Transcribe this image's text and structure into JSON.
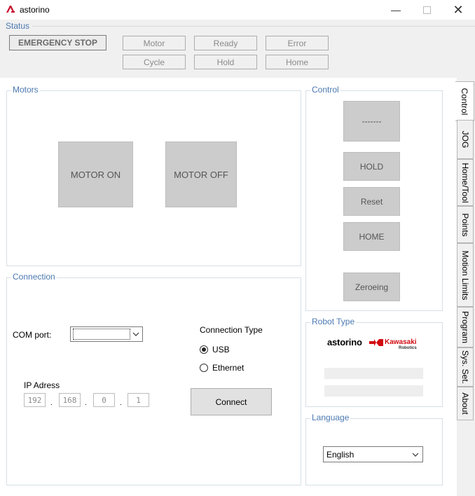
{
  "window": {
    "title": "astorino",
    "controls": [
      "minimize",
      "maximize",
      "close"
    ]
  },
  "status": {
    "label": "Status",
    "emergency_stop": "EMERGENCY STOP",
    "flags": [
      "Motor",
      "Ready",
      "Error",
      "Cycle",
      "Hold",
      "Home"
    ]
  },
  "motors": {
    "label": "Motors",
    "on": "MOTOR ON",
    "off": "MOTOR OFF"
  },
  "control": {
    "label": "Control",
    "buttons": [
      "-------",
      "HOLD",
      "Reset",
      "HOME",
      "Zeroeing"
    ]
  },
  "connection": {
    "label": "Connection",
    "com_label": "COM port:",
    "com_value": "",
    "type_label": "Connection Type",
    "options": [
      {
        "label": "USB",
        "selected": true
      },
      {
        "label": "Ethernet",
        "selected": false
      }
    ],
    "ip_label": "IP Adress",
    "ip": [
      "192",
      "168",
      "0",
      "1"
    ],
    "connect": "Connect"
  },
  "robot_type": {
    "label": "Robot Type",
    "brand1": "astorino",
    "brand2": "Kawasaki",
    "brand2_sub": "Robotics",
    "brand2_color": "#d10a11"
  },
  "language": {
    "label": "Language",
    "value": "English"
  },
  "tabs": [
    "Control",
    "JOG",
    "Home/Tool",
    "Points",
    "Motion Limits",
    "Program",
    "Sys. Set.",
    "About"
  ],
  "colors": {
    "accent": "#4a78b0",
    "logo": "#c8102e"
  }
}
